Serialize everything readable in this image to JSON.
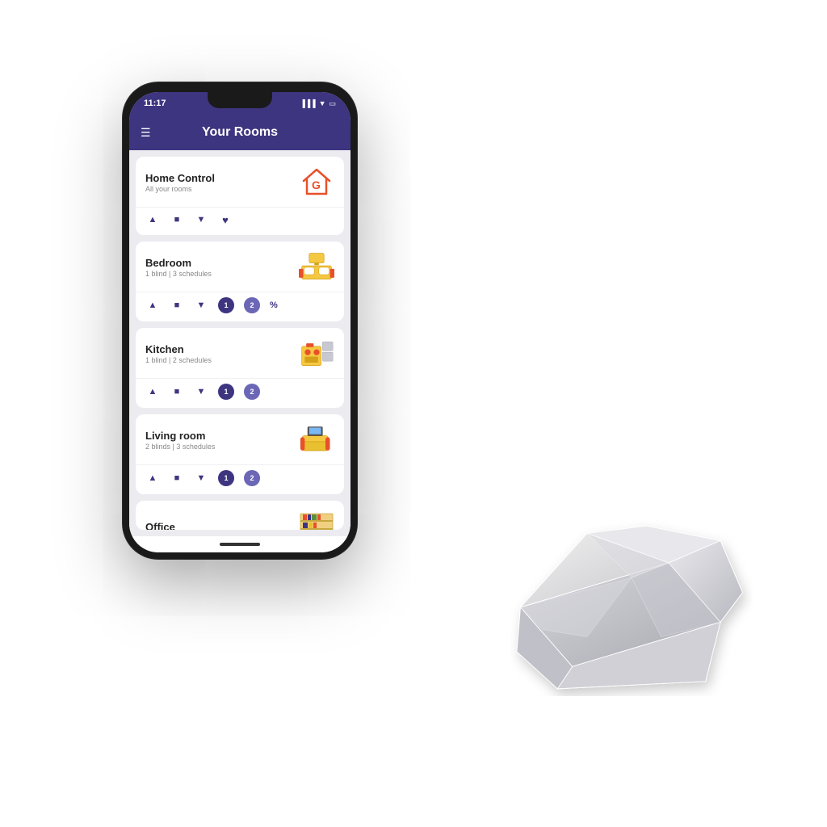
{
  "status_bar": {
    "time": "11:17",
    "icons": "▲ ▼ ▶"
  },
  "header": {
    "menu_label": "☰",
    "title": "Your Rooms"
  },
  "rooms": [
    {
      "id": "home-control",
      "name": "Home Control",
      "subtitle": "All your rooms",
      "controls": [
        "up",
        "stop",
        "down",
        "heart"
      ],
      "has_pct": false,
      "has_schedules": false,
      "schedules_count": 0
    },
    {
      "id": "bedroom",
      "name": "Bedroom",
      "subtitle": "1 blind | 3 schedules",
      "controls": [
        "up",
        "stop",
        "down"
      ],
      "has_schedules": true,
      "schedules_count": 2,
      "has_pct": true
    },
    {
      "id": "kitchen",
      "name": "Kitchen",
      "subtitle": "1 blind | 2 schedules",
      "controls": [
        "up",
        "stop",
        "down"
      ],
      "has_schedules": true,
      "schedules_count": 2,
      "has_pct": false
    },
    {
      "id": "living-room",
      "name": "Living room",
      "subtitle": "2 blinds | 3 schedules",
      "controls": [
        "up",
        "stop",
        "down"
      ],
      "has_schedules": true,
      "schedules_count": 2,
      "has_pct": false
    },
    {
      "id": "office",
      "name": "Office",
      "subtitle": "",
      "controls": [],
      "has_schedules": false,
      "schedules_count": 0,
      "has_pct": false
    }
  ],
  "labels": {
    "pct": "%"
  }
}
